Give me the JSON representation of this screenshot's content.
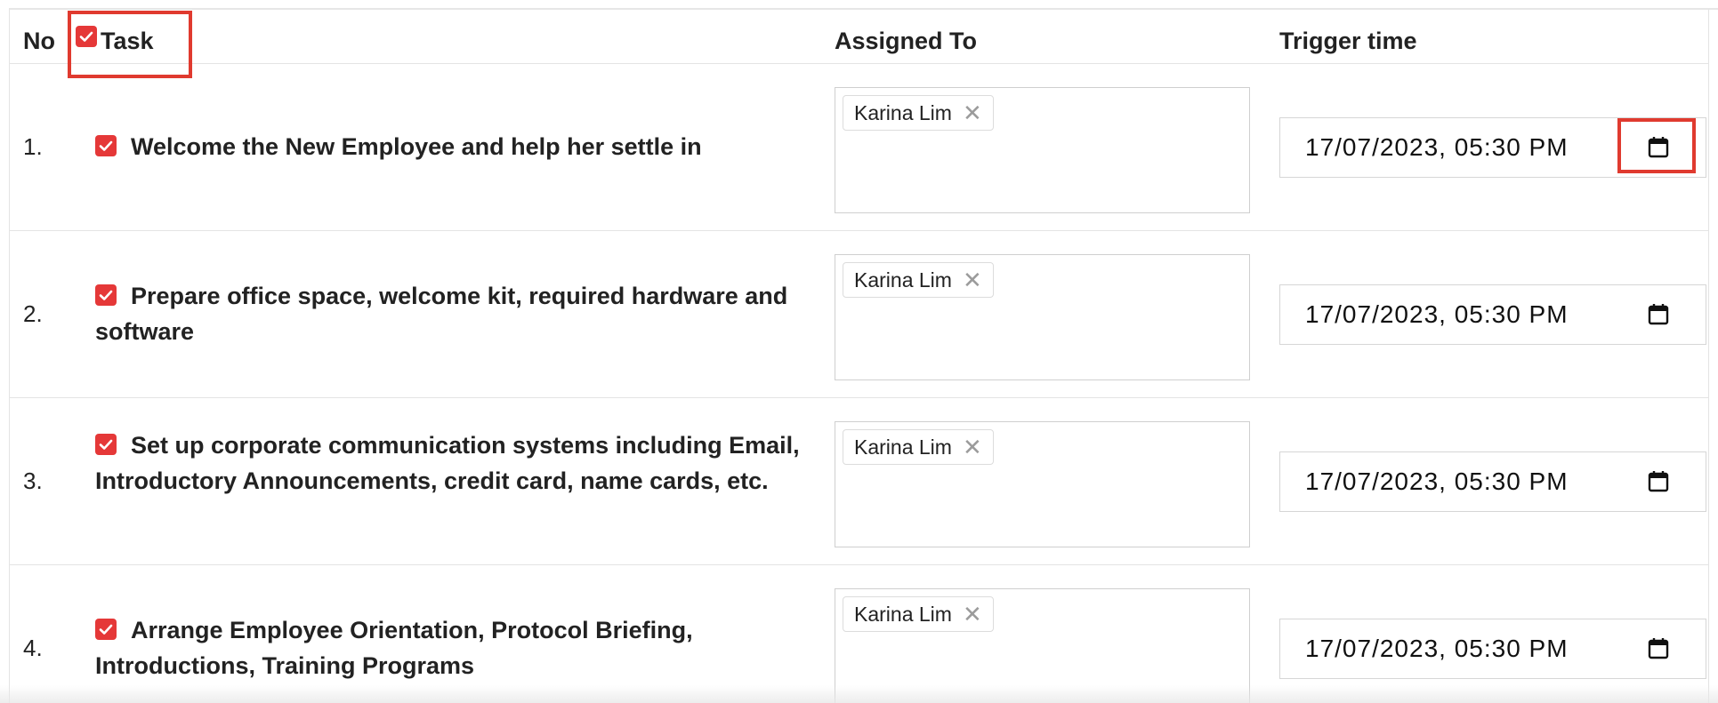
{
  "table": {
    "headers": {
      "no": "No",
      "task": "Task",
      "assigned_to": "Assigned To",
      "trigger_time": "Trigger time"
    },
    "rows": [
      {
        "num": "1.",
        "task": "Welcome the New Employee and help her settle in",
        "assignee": "Karina Lim",
        "trigger": "17/07/2023, 05:30 PM"
      },
      {
        "num": "2.",
        "task": "Prepare office space, welcome kit, required hardware and software",
        "assignee": "Karina Lim",
        "trigger": "17/07/2023, 05:30 PM"
      },
      {
        "num": "3.",
        "task": "Set up corporate communication systems including Email, Introductory Announcements, credit card, name cards, etc.",
        "assignee": "Karina Lim",
        "trigger": "17/07/2023, 05:30 PM"
      },
      {
        "num": "4.",
        "task": "Arrange Employee Orientation, Protocol Briefing, Introductions, Training Programs",
        "assignee": "Karina Lim",
        "trigger": "17/07/2023, 05:30 PM"
      }
    ]
  },
  "icons": {
    "checkbox": "checkbox-checked-icon",
    "remove": "close-icon",
    "calendar": "calendar-icon"
  },
  "colors": {
    "checkbox": "#e53838",
    "highlight": "#e03a2f",
    "border": "#e4e4e4"
  }
}
